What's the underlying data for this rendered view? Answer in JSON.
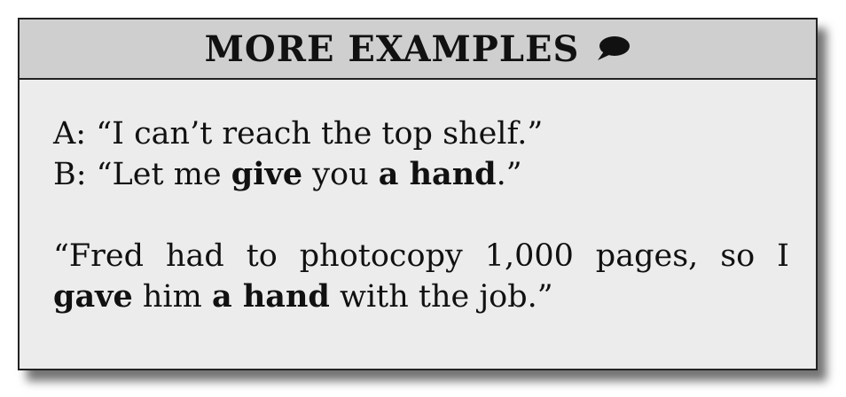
{
  "header": {
    "title": "MORE EXAMPLES",
    "icon": "speech-bubble-icon"
  },
  "dialogue": [
    {
      "speaker": "A:",
      "parts": [
        "“I can’t reach the top shelf.”"
      ]
    },
    {
      "speaker": "B:",
      "parts": [
        "“Let me ",
        "give",
        " you ",
        "a hand",
        ".”"
      ]
    }
  ],
  "example": {
    "parts": [
      "“Fred had to photocopy 1,000 pages, so I ",
      "gave",
      " him ",
      "a hand",
      " with the job.”"
    ]
  },
  "colors": {
    "header_bg": "#cfcfcf",
    "body_bg": "#ececec",
    "border": "#222222"
  }
}
